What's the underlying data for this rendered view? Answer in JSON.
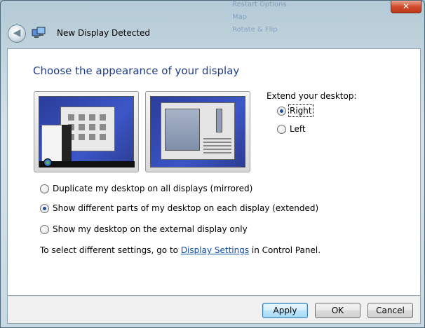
{
  "window": {
    "title": "New Display Detected",
    "close_label": "✕",
    "back_label": "◀"
  },
  "background_menu": [
    "Restart Options",
    "Map",
    "Rotate & Flip"
  ],
  "heading": "Choose the appearance of your display",
  "extend": {
    "label": "Extend your desktop:",
    "options": [
      {
        "label": "Right",
        "checked": true
      },
      {
        "label": "Left",
        "checked": false
      }
    ]
  },
  "modes": [
    {
      "label": "Duplicate my desktop on all displays (mirrored)",
      "checked": false
    },
    {
      "label": "Show different parts of my desktop on each display (extended)",
      "checked": true
    },
    {
      "label": "Show my desktop on the external display only",
      "checked": false
    }
  ],
  "info": {
    "prefix": "To select different settings, go to ",
    "link": "Display Settings",
    "suffix": " in Control Panel."
  },
  "buttons": {
    "apply": "Apply",
    "ok": "OK",
    "cancel": "Cancel"
  },
  "colors": {
    "heading": "#1f3c8a",
    "link": "#0c4fa8",
    "desktop_blue": "#2b3d9a"
  },
  "icons": {
    "back": "back-arrow-icon",
    "app": "display-icon",
    "close": "close-icon"
  }
}
